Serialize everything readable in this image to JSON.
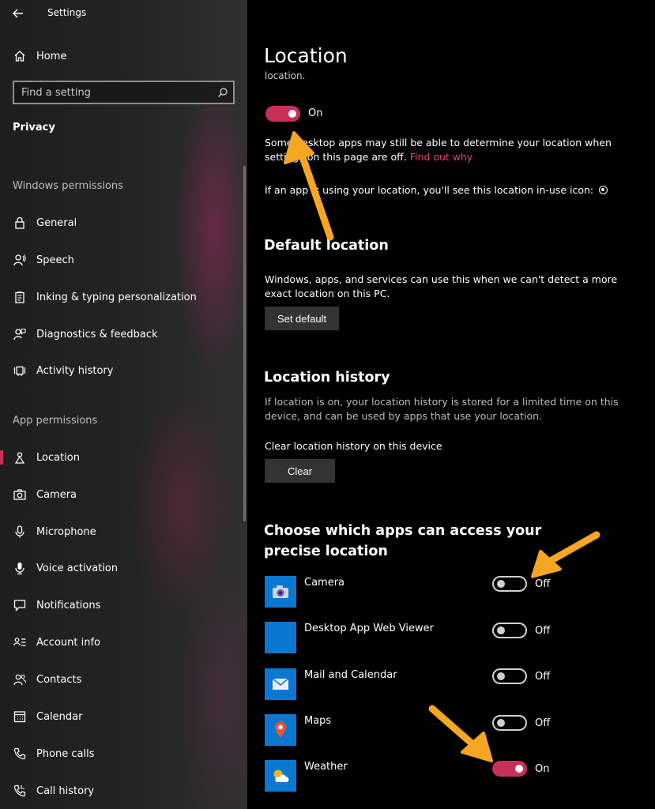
{
  "window": {
    "title": "Settings"
  },
  "sidebar": {
    "home": "Home",
    "search_placeholder": "Find a setting",
    "category": "Privacy",
    "windows_permissions_title": "Windows permissions",
    "windows_permissions": [
      {
        "label": "General",
        "icon": "lock-icon"
      },
      {
        "label": "Speech",
        "icon": "speech-icon"
      },
      {
        "label": "Inking & typing personalization",
        "icon": "clipboard-icon"
      },
      {
        "label": "Diagnostics & feedback",
        "icon": "feedback-icon"
      },
      {
        "label": "Activity history",
        "icon": "activity-icon"
      }
    ],
    "app_permissions_title": "App permissions",
    "app_permissions": [
      {
        "label": "Location",
        "icon": "location-icon",
        "selected": true
      },
      {
        "label": "Camera",
        "icon": "camera-icon"
      },
      {
        "label": "Microphone",
        "icon": "microphone-icon"
      },
      {
        "label": "Voice activation",
        "icon": "voice-icon"
      },
      {
        "label": "Notifications",
        "icon": "notifications-icon"
      },
      {
        "label": "Account info",
        "icon": "account-info-icon"
      },
      {
        "label": "Contacts",
        "icon": "contacts-icon"
      },
      {
        "label": "Calendar",
        "icon": "calendar-icon"
      },
      {
        "label": "Phone calls",
        "icon": "phone-icon"
      },
      {
        "label": "Call history",
        "icon": "call-history-icon"
      }
    ]
  },
  "main": {
    "title": "Location",
    "clipped_text": "location.",
    "master_toggle": {
      "state": "On"
    },
    "desktop_note": "Some desktop apps may still be able to determine your location when settings on this page are off.",
    "find_out_why": "Find out why",
    "inuse_note": "If an app is using your location, you'll see this location in-use icon:",
    "default_location": {
      "heading": "Default location",
      "description": "Windows, apps, and services can use this when we can't detect a more exact location on this PC.",
      "button": "Set default"
    },
    "location_history": {
      "heading": "Location history",
      "description": "If location is on, your location history is stored for a limited time on this device, and can be used by apps that use your location.",
      "clear_label": "Clear location history on this device",
      "button": "Clear"
    },
    "apps_section": {
      "heading": "Choose which apps can access your precise location",
      "apps": [
        {
          "name": "Camera",
          "state": "Off",
          "on": false
        },
        {
          "name": "Desktop App Web Viewer",
          "state": "Off",
          "on": false
        },
        {
          "name": "Mail and Calendar",
          "state": "Off",
          "on": false
        },
        {
          "name": "Maps",
          "state": "Off",
          "on": false
        },
        {
          "name": "Weather",
          "state": "On",
          "on": true
        }
      ]
    }
  },
  "colors": {
    "accent": "#c8305a",
    "link": "#e0486f",
    "app_tile": "#0a78d0",
    "arrow": "#f5a623"
  }
}
